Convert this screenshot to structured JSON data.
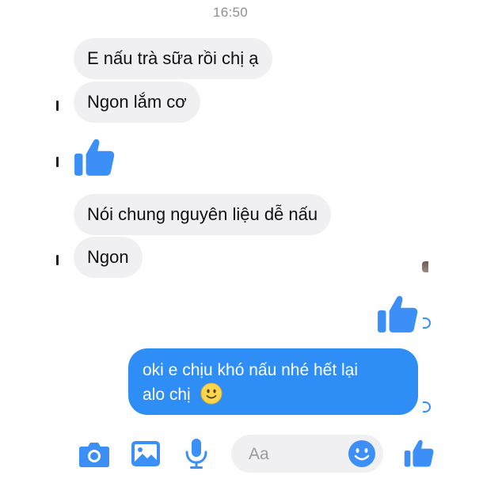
{
  "timestamp": "16:50",
  "messages_in": [
    {
      "text": "E nấu trà sữa rồi chị ạ"
    },
    {
      "text": "Ngon lắm cơ"
    },
    {
      "text": "Nói chung nguyên liệu dễ nấu"
    },
    {
      "text": "Ngon"
    }
  ],
  "message_out": {
    "line1": "oki e chịu khó nấu nhé hết lại",
    "line2": "alo chị"
  },
  "composer": {
    "placeholder": "Aa"
  },
  "icons": {
    "camera": "camera-icon",
    "photo": "image-icon",
    "microphone": "microphone-icon",
    "emoji": "smiley-icon",
    "like": "thumbs-up-icon"
  },
  "colors": {
    "accent": "#3b8ff6",
    "bubble_in": "#f0f0f2",
    "bubble_out": "#2f8df6",
    "timestamp": "#8e8e93"
  }
}
